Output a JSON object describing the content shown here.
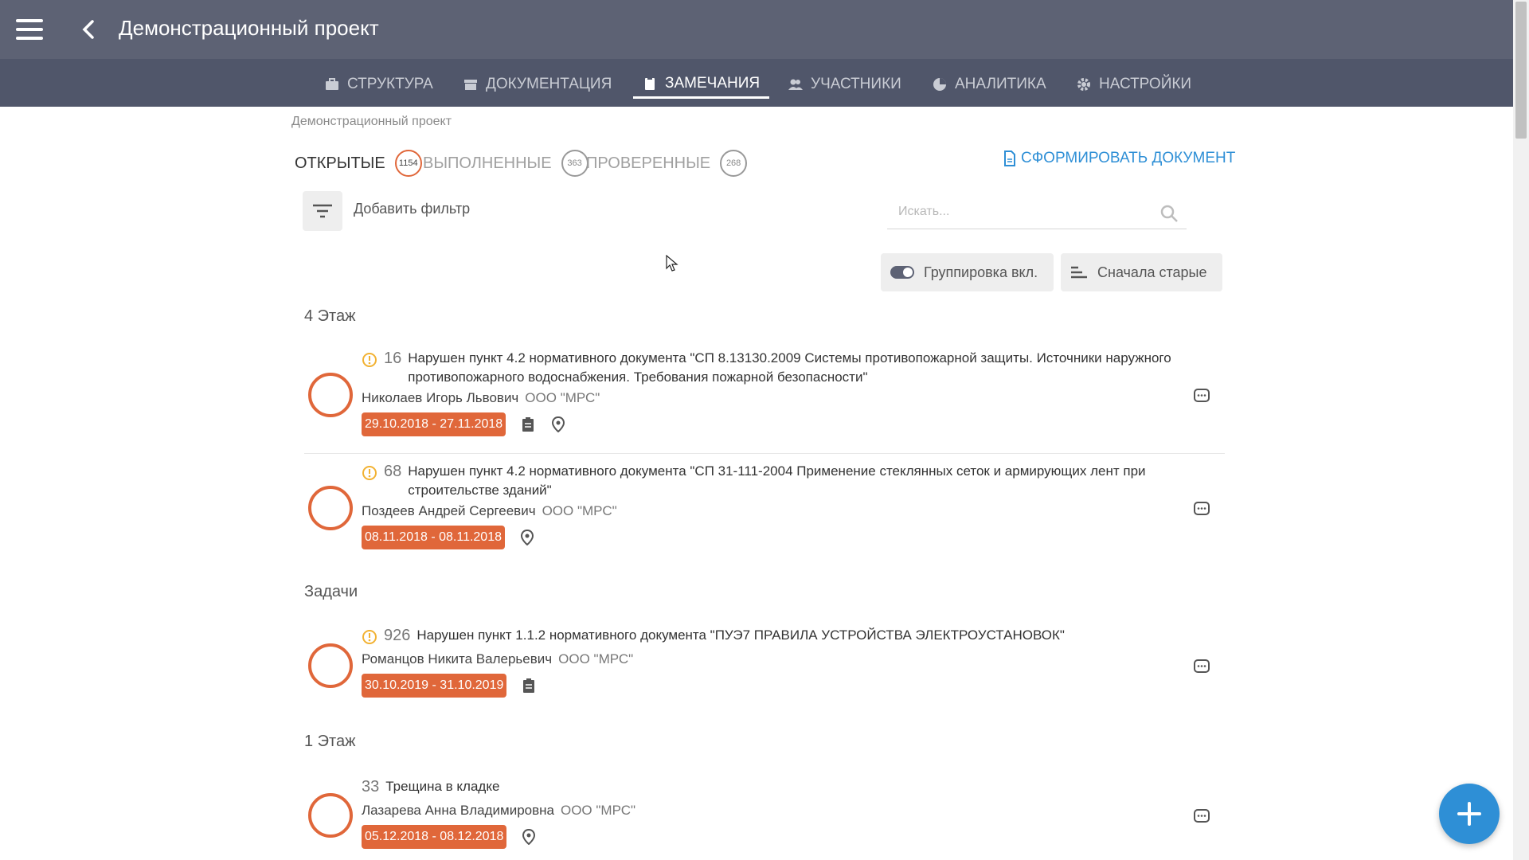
{
  "header": {
    "title": "Демонстрационный проект"
  },
  "nav": {
    "tabs": [
      {
        "label": "СТРУКТУРА",
        "icon": "briefcase-icon"
      },
      {
        "label": "ДОКУМЕНТАЦИЯ",
        "icon": "archive-icon"
      },
      {
        "label": "ЗАМЕЧАНИЯ",
        "icon": "clipboard-icon",
        "active": true
      },
      {
        "label": "УЧАСТНИКИ",
        "icon": "users-icon"
      },
      {
        "label": "АНАЛИТИКА",
        "icon": "pie-chart-icon"
      },
      {
        "label": "НАСТРОЙКИ",
        "icon": "gear-icon"
      }
    ]
  },
  "breadcrumb": "Демонстрационный проект",
  "status_tabs": [
    {
      "label": "ОТКРЫТЫЕ",
      "count": "1154",
      "active": true
    },
    {
      "label": "ВЫПОЛНЕННЫЕ",
      "count": "363"
    },
    {
      "label": "ПРОВЕРЕННЫЕ",
      "count": "268"
    }
  ],
  "generate_doc_label": "СФОРМИРОВАТЬ ДОКУМЕНТ",
  "filter": {
    "label": "Добавить фильтр"
  },
  "search": {
    "placeholder": "Искать..."
  },
  "grouping_label": "Группировка вкл.",
  "sort_label": "Сначала старые",
  "groups": [
    {
      "title": "4 Этаж",
      "items": [
        {
          "num": "16",
          "warning": true,
          "line1": "Нарушен пункт 4.2 нормативного документа \"СП 8.13130.2009 Системы противопожарной защиты. Источники наружного",
          "line2": "противопожарного водоснабжения. Требования пожарной безопасности\"",
          "person": "Николаев Игорь Львович",
          "org": "ООО \"МРС\"",
          "dates": "29.10.2018 - 27.11.2018"
        },
        {
          "num": "68",
          "warning": true,
          "line1": "Нарушен пункт 4.2 нормативного документа \"СП 31-111-2004 Применение стеклянных сеток и армирующих лент при",
          "line2": "строительстве зданий\"",
          "person": "Поздеев Андрей Сергеевич",
          "org": "ООО \"МРС\"",
          "dates": "08.11.2018 - 08.11.2018"
        }
      ]
    },
    {
      "title": "Задачи",
      "items": [
        {
          "num": "926",
          "warning": true,
          "line1": "Нарушен пункт 1.1.2 нормативного документа \"ПУЭ7 ПРАВИЛА УСТРОЙСТВА ЭЛЕКТРОУСТАНОВОК\"",
          "person": "Романцов Никита Валерьевич",
          "org": "ООО \"МРС\"",
          "dates": "30.10.2019 - 31.10.2019"
        }
      ]
    },
    {
      "title": "1 Этаж",
      "items": [
        {
          "num": "33",
          "warning": false,
          "line1": "Трещина в кладке",
          "person": "Лазарева Анна Владимировна",
          "org": "ООО \"МРС\"",
          "dates": "05.12.2018 - 08.12.2018"
        }
      ]
    }
  ],
  "colors": {
    "accent": "#e0673a",
    "link": "#2e8fd6",
    "topbar": "#5d6274",
    "navbar": "#50566a"
  }
}
